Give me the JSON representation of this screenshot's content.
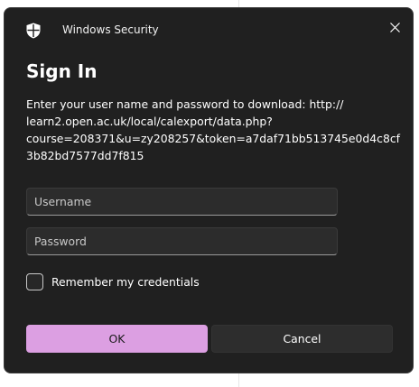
{
  "window": {
    "app_title": "Windows Security"
  },
  "dialog": {
    "heading": "Sign In",
    "message_lines": [
      "Enter your user name and password to download: http://",
      "learn2.open.ac.uk/local/calexport/data.php?",
      "course=208371&u=zy208257&token=a7daf71bb513745e0d4c8cf",
      "3b82bd7577dd7f815"
    ]
  },
  "form": {
    "username_placeholder": "Username",
    "password_placeholder": "Password",
    "remember_label": "Remember my credentials",
    "remember_checked": false
  },
  "buttons": {
    "ok_label": "OK",
    "cancel_label": "Cancel"
  },
  "colors": {
    "dialog_bg": "#202020",
    "accent": "#dc9fe2"
  },
  "icons": {
    "app": "shield-icon",
    "close": "close-icon"
  }
}
